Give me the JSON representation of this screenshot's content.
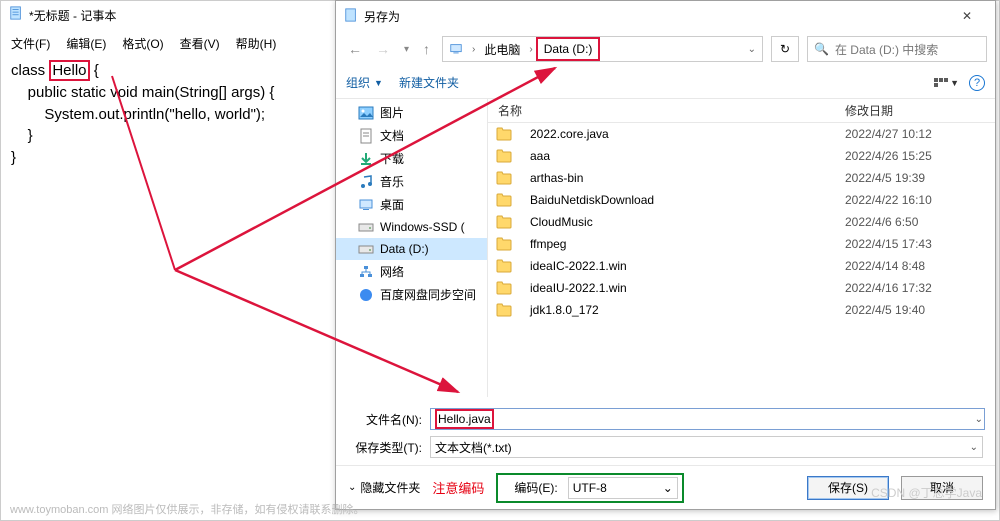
{
  "notepad": {
    "title": "*无标题 - 记事本",
    "menu": [
      "文件(F)",
      "编辑(E)",
      "格式(O)",
      "查看(V)",
      "帮助(H)"
    ],
    "code_prefix": "class ",
    "code_classname": "Hello",
    "code_rest": " {\n    public static void main(String[] args) {\n        System.out.println(\"hello, world\");\n    }\n}"
  },
  "dialog": {
    "title": "另存为",
    "breadcrumb": {
      "pc": "此电脑",
      "drive": "Data (D:)"
    },
    "search_placeholder": "在 Data (D:) 中搜索",
    "toolbar": {
      "organize": "组织",
      "newfolder": "新建文件夹"
    },
    "tree": [
      {
        "label": "图片",
        "icon": "picture"
      },
      {
        "label": "文档",
        "icon": "document"
      },
      {
        "label": "下载",
        "icon": "download"
      },
      {
        "label": "音乐",
        "icon": "music"
      },
      {
        "label": "桌面",
        "icon": "desktop"
      },
      {
        "label": "Windows-SSD (",
        "icon": "drive"
      },
      {
        "label": "Data (D:)",
        "icon": "drive",
        "selected": true
      },
      {
        "label": "网络",
        "icon": "network"
      },
      {
        "label": "百度网盘同步空间",
        "icon": "baidu"
      }
    ],
    "columns": {
      "name": "名称",
      "date": "修改日期"
    },
    "rows": [
      {
        "name": "2022.core.java",
        "date": "2022/4/27 10:12"
      },
      {
        "name": "aaa",
        "date": "2022/4/26 15:25"
      },
      {
        "name": "arthas-bin",
        "date": "2022/4/5 19:39"
      },
      {
        "name": "BaiduNetdiskDownload",
        "date": "2022/4/22 16:10"
      },
      {
        "name": "CloudMusic",
        "date": "2022/4/6 6:50"
      },
      {
        "name": "ffmpeg",
        "date": "2022/4/15 17:43"
      },
      {
        "name": "ideaIC-2022.1.win",
        "date": "2022/4/14 8:48"
      },
      {
        "name": "ideaIU-2022.1.win",
        "date": "2022/4/16 17:32"
      },
      {
        "name": "jdk1.8.0_172",
        "date": "2022/4/5 19:40"
      }
    ],
    "filename_label": "文件名(N):",
    "filename_value": "Hello.java",
    "filetype_label": "保存类型(T):",
    "filetype_value": "文本文档(*.txt)",
    "hide_folders": "隐藏文件夹",
    "note_encoding": "注意编码",
    "encoding_label": "编码(E):",
    "encoding_value": "UTF-8",
    "save_btn": "保存(S)",
    "cancel_btn": "取消"
  },
  "footer": "www.toymoban.com  网络图片仅供展示，非存储，如有侵权请联系删除。",
  "watermark": "CSDN @丁总学Java"
}
